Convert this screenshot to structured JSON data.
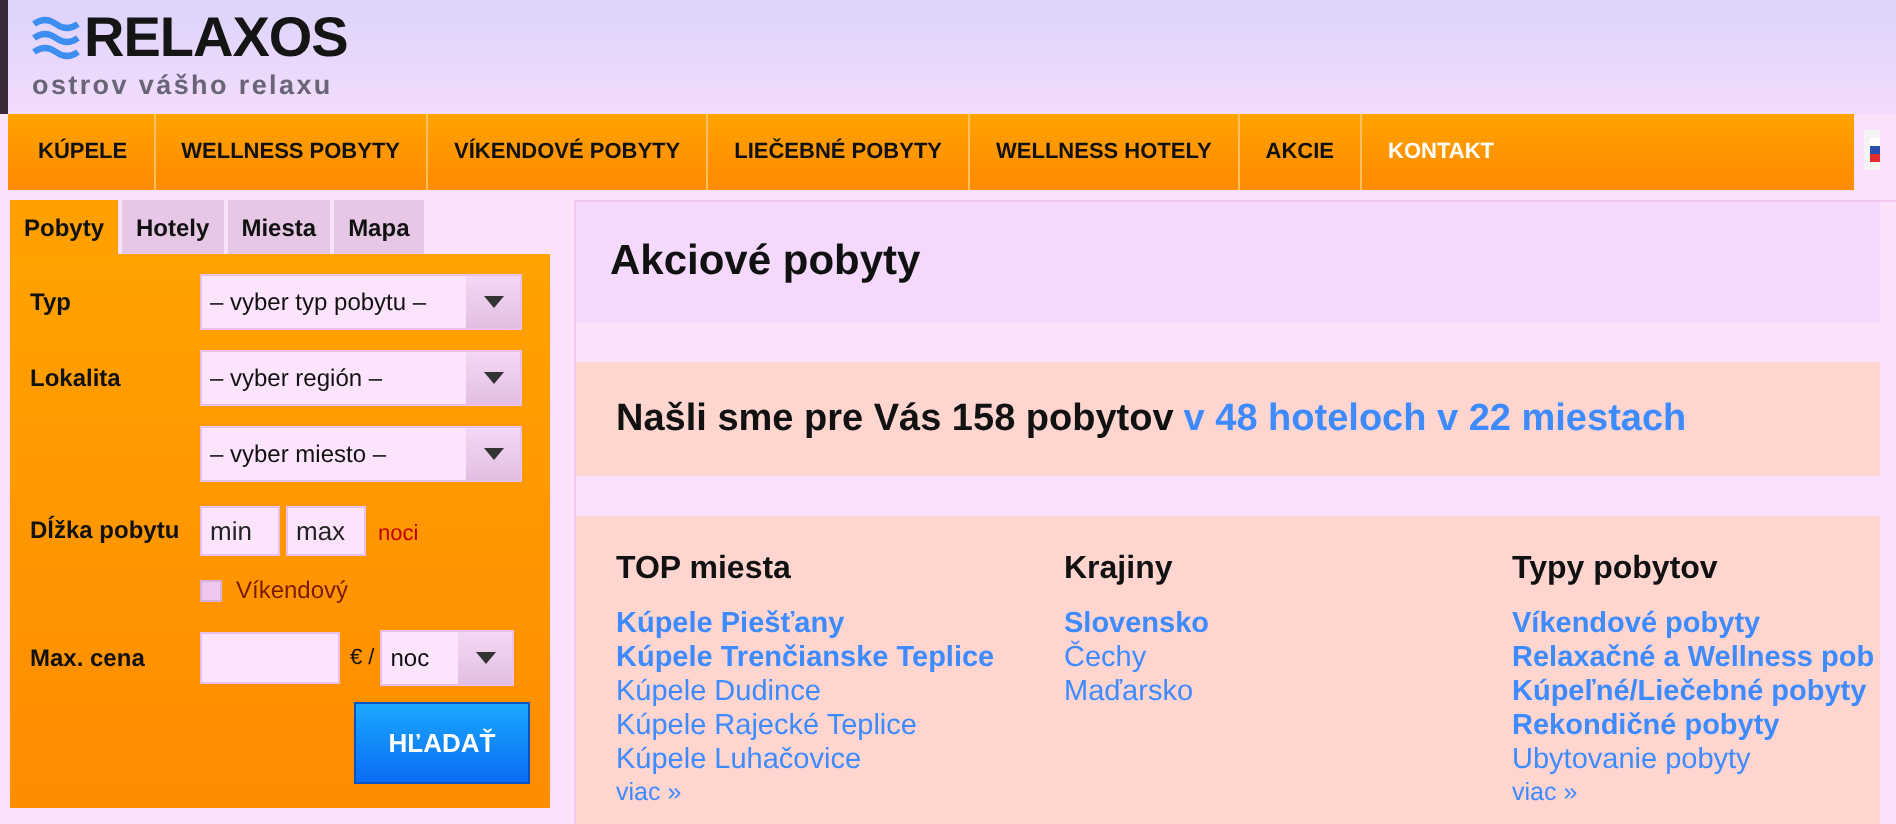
{
  "logo": {
    "name": "RELAXOS",
    "tagline": "ostrov vášho relaxu"
  },
  "nav": [
    {
      "label": "KÚPELE",
      "highlighted": false
    },
    {
      "label": "WELLNESS POBYTY",
      "highlighted": false
    },
    {
      "label": "VÍKENDOVÉ POBYTY",
      "highlighted": false
    },
    {
      "label": "LIEČEBNÉ POBYTY",
      "highlighted": false
    },
    {
      "label": "WELLNESS HOTELY",
      "highlighted": false
    },
    {
      "label": "AKCIE",
      "highlighted": false
    },
    {
      "label": "KONTAKT",
      "highlighted": true
    }
  ],
  "search_tabs": [
    {
      "label": "Pobyty",
      "selected": true
    },
    {
      "label": "Hotely",
      "selected": false
    },
    {
      "label": "Miesta",
      "selected": false
    },
    {
      "label": "Mapa",
      "selected": false
    }
  ],
  "form": {
    "type": {
      "label": "Typ",
      "value": "– vyber typ pobytu –"
    },
    "location": {
      "label": "Lokalita",
      "region": "– vyber región –",
      "city": "– vyber miesto –"
    },
    "length": {
      "label": "Dĺžka pobytu",
      "min_placeholder": "min",
      "max_placeholder": "max",
      "unit": "noci"
    },
    "weekend": {
      "label": "Víkendový",
      "checked": false
    },
    "price": {
      "label": "Max. cena",
      "currency": "€ /",
      "period": "noc"
    },
    "submit": "HĽADAŤ"
  },
  "main": {
    "title": "Akciové pobyty",
    "results": {
      "text": "Našli sme pre Vás 158 pobytov",
      "link": "v 48 hoteloch v 22 miestach"
    },
    "columns": [
      {
        "heading": "TOP miesta",
        "links": [
          {
            "label": "Kúpele Piešťany",
            "featured": true
          },
          {
            "label": "Kúpele Trenčianske Teplice",
            "featured": true
          },
          {
            "label": "Kúpele Dudince",
            "featured": false
          },
          {
            "label": "Kúpele Rajecké Teplice",
            "featured": false
          },
          {
            "label": "Kúpele Luhačovice",
            "featured": false
          }
        ],
        "more": "viac »"
      },
      {
        "heading": "Krajiny",
        "links": [
          {
            "label": "Slovensko",
            "featured": true
          },
          {
            "label": "Čechy",
            "featured": false
          },
          {
            "label": "Maďarsko",
            "featured": false
          }
        ]
      },
      {
        "heading": "Typy pobytov",
        "links": [
          {
            "label": "Víkendové pobyty",
            "featured": true
          },
          {
            "label": "Relaxačné a Wellness pob",
            "featured": true
          },
          {
            "label": "Kúpeľné/Liečebné pobyty",
            "featured": true
          },
          {
            "label": "Rekondičné pobyty",
            "featured": true
          },
          {
            "label": "Ubytovanie pobyty",
            "featured": false
          }
        ],
        "more": "viac »"
      }
    ]
  }
}
